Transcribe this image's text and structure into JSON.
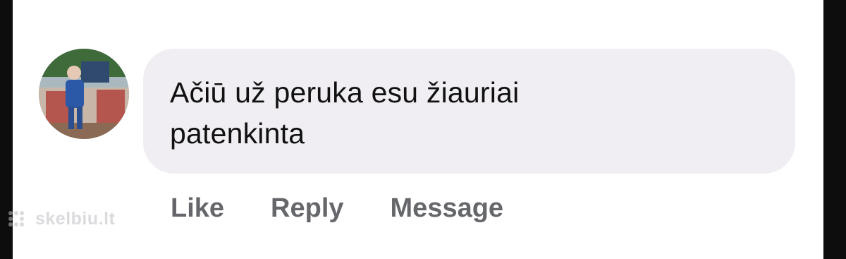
{
  "comment": {
    "text": "Ačiū už peruka esu žiauriai patenkinta",
    "avatar_icon": "profile-photo"
  },
  "actions": {
    "like_label": "Like",
    "reply_label": "Reply",
    "message_label": "Message"
  },
  "watermark": {
    "text": "skelbiu.lt"
  },
  "colors": {
    "bubble_background": "#f0eef3",
    "comment_text": "#111111",
    "action_text": "#65676b",
    "page_background": "#ffffff",
    "side_bars": "#0d0d0d"
  }
}
